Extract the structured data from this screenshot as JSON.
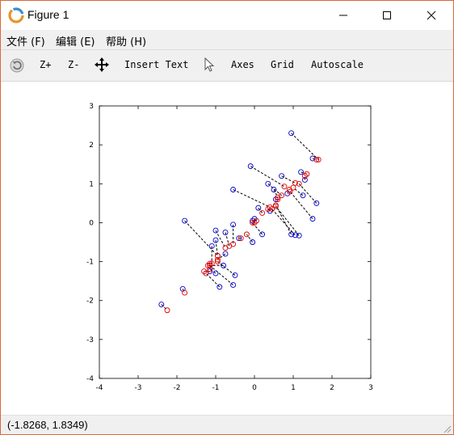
{
  "window": {
    "title": "Figure 1",
    "accent_border": "#d86a3a"
  },
  "menubar": {
    "items": [
      {
        "label": "文件 (F)"
      },
      {
        "label": "编辑 (E)"
      },
      {
        "label": "帮助 (H)"
      }
    ]
  },
  "toolbar": {
    "rotate_icon": "rotate-icon",
    "zoom_in_label": "Z+",
    "zoom_out_label": "Z-",
    "pan_icon": "pan-arrows-icon",
    "insert_text_label": "Insert Text",
    "select_icon": "cursor-arrow-icon",
    "axes_label": "Axes",
    "grid_label": "Grid",
    "autoscale_label": "Autoscale"
  },
  "chart_data": {
    "type": "scatter",
    "xlim": [
      -4,
      3
    ],
    "ylim": [
      -4,
      3
    ],
    "x_ticks": [
      "-4",
      "-3",
      "-2",
      "-1",
      "0",
      "1",
      "2",
      "3"
    ],
    "y_ticks": [
      "3",
      "2",
      "1",
      "0",
      "-1",
      "-2",
      "-3",
      "-4"
    ],
    "grid": false,
    "colors": {
      "original": "#0000cc",
      "projected": "#dd0000",
      "projection_lines": "#000000"
    },
    "pairs": [
      {
        "orig": [
          0.95,
          2.3
        ],
        "proj": [
          1.65,
          1.62
        ]
      },
      {
        "orig": [
          1.5,
          1.65
        ],
        "proj": [
          1.6,
          1.62
        ]
      },
      {
        "orig": [
          -0.1,
          1.45
        ],
        "proj": [
          0.77,
          0.93
        ]
      },
      {
        "orig": [
          0.7,
          1.2
        ],
        "proj": [
          1.05,
          1.02
        ]
      },
      {
        "orig": [
          1.2,
          1.3
        ],
        "proj": [
          1.35,
          1.25
        ]
      },
      {
        "orig": [
          0.35,
          1.0
        ],
        "proj": [
          0.7,
          0.7
        ]
      },
      {
        "orig": [
          0.5,
          0.85
        ],
        "proj": [
          0.6,
          0.65
        ]
      },
      {
        "orig": [
          -0.55,
          0.85
        ],
        "proj": [
          0.4,
          0.4
        ]
      },
      {
        "orig": [
          0.85,
          0.75
        ],
        "proj": [
          0.9,
          0.85
        ]
      },
      {
        "orig": [
          1.3,
          1.1
        ],
        "proj": [
          1.3,
          1.2
        ]
      },
      {
        "orig": [
          1.25,
          0.7
        ],
        "proj": [
          1.0,
          0.9
        ]
      },
      {
        "orig": [
          1.6,
          0.5
        ],
        "proj": [
          1.15,
          1.0
        ]
      },
      {
        "orig": [
          1.5,
          0.1
        ],
        "proj": [
          0.92,
          0.8
        ]
      },
      {
        "orig": [
          0.1,
          0.38
        ],
        "proj": [
          0.2,
          0.25
        ]
      },
      {
        "orig": [
          0.4,
          0.3
        ],
        "proj": [
          0.35,
          0.35
        ]
      },
      {
        "orig": [
          0.0,
          0.1
        ],
        "proj": [
          0.05,
          0.05
        ]
      },
      {
        "orig": [
          -0.05,
          0.05
        ],
        "proj": [
          0.0,
          0.0
        ]
      },
      {
        "orig": [
          0.2,
          -0.3
        ],
        "proj": [
          -0.05,
          0.0
        ]
      },
      {
        "orig": [
          1.05,
          -0.32
        ],
        "proj": [
          0.45,
          0.35
        ]
      },
      {
        "orig": [
          1.15,
          -0.33
        ],
        "proj": [
          0.55,
          0.42
        ]
      },
      {
        "orig": [
          -0.55,
          -0.05
        ],
        "proj": [
          -0.55,
          -0.55
        ]
      },
      {
        "orig": [
          -1.8,
          0.05
        ],
        "proj": [
          -0.95,
          -0.85
        ]
      },
      {
        "orig": [
          -1.0,
          -0.2
        ],
        "proj": [
          -0.75,
          -0.65
        ]
      },
      {
        "orig": [
          -0.75,
          -0.25
        ],
        "proj": [
          -0.65,
          -0.6
        ]
      },
      {
        "orig": [
          -0.4,
          -0.4
        ],
        "proj": [
          -0.35,
          -0.4
        ]
      },
      {
        "orig": [
          -0.05,
          -0.5
        ],
        "proj": [
          -0.2,
          -0.3
        ]
      },
      {
        "orig": [
          -1.0,
          -0.45
        ],
        "proj": [
          -0.95,
          -0.85
        ]
      },
      {
        "orig": [
          -1.1,
          -0.6
        ],
        "proj": [
          -1.1,
          -1.05
        ]
      },
      {
        "orig": [
          -1.15,
          -1.1
        ],
        "proj": [
          -1.15,
          -1.05
        ]
      },
      {
        "orig": [
          -0.75,
          -0.8
        ],
        "proj": [
          -0.95,
          -0.95
        ]
      },
      {
        "orig": [
          -0.8,
          -1.1
        ],
        "proj": [
          -1.2,
          -1.1
        ]
      },
      {
        "orig": [
          -1.15,
          -1.25
        ],
        "proj": [
          -1.3,
          -1.25
        ]
      },
      {
        "orig": [
          -1.0,
          -1.3
        ],
        "proj": [
          -1.15,
          -1.2
        ]
      },
      {
        "orig": [
          -0.5,
          -1.35
        ],
        "proj": [
          -0.95,
          -1.0
        ]
      },
      {
        "orig": [
          -0.55,
          -1.6
        ],
        "proj": [
          -1.15,
          -1.1
        ]
      },
      {
        "orig": [
          -0.9,
          -1.65
        ],
        "proj": [
          -1.25,
          -1.3
        ]
      },
      {
        "orig": [
          -1.85,
          -1.7
        ],
        "proj": [
          -1.8,
          -1.8
        ]
      },
      {
        "orig": [
          -2.4,
          -2.1
        ],
        "proj": [
          -2.25,
          -2.25
        ]
      },
      {
        "orig": [
          0.95,
          -0.3
        ],
        "proj": [
          0.55,
          0.45
        ]
      },
      {
        "orig": [
          0.55,
          0.6
        ],
        "proj": [
          0.6,
          0.6
        ]
      }
    ]
  },
  "status": {
    "coords": "(-1.8268, 1.8349)"
  }
}
